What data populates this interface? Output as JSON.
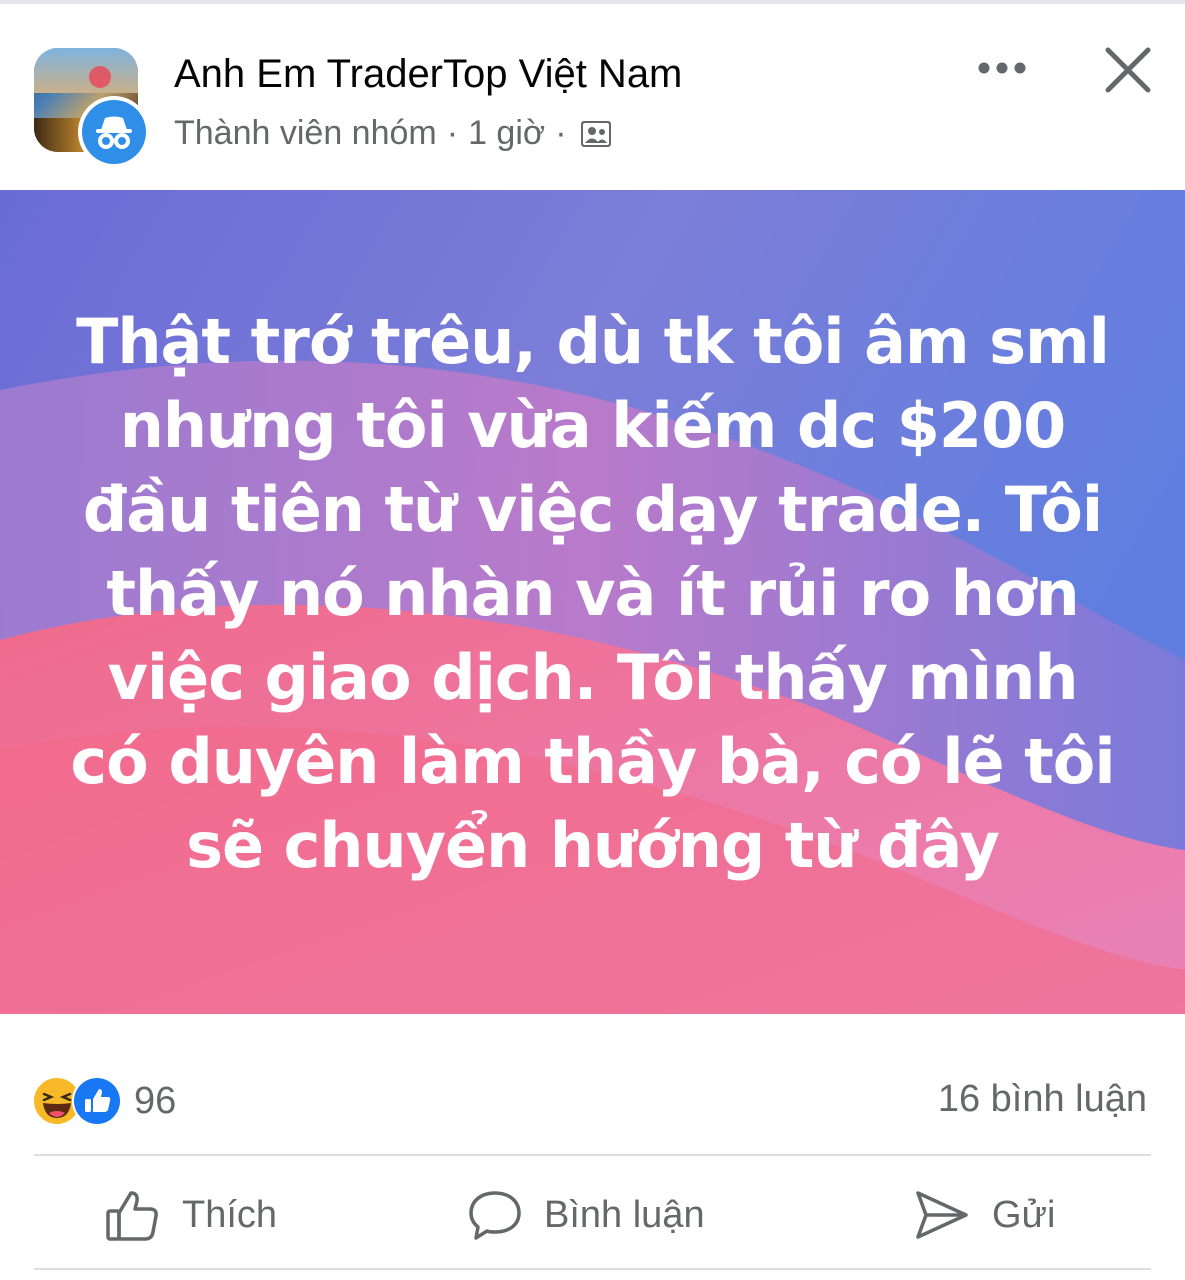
{
  "post": {
    "group_name": "Anh Em TraderTop Việt Nam",
    "author_role": "Thành viên nhóm",
    "time": "1 giờ",
    "separator": "·",
    "text": "Thật trớ trêu, dù tk tôi âm sml nhưng tôi vừa kiếm dc $200 đầu tiên từ việc dạy trade. Tôi thấy nó nhàn và ít rủi ro hơn việc giao dịch. Tôi thấy mình có duyên làm thầy bà, có lẽ tôi sẽ chuyển hướng từ đây",
    "background_colors": [
      "#6c70dc",
      "#8a7ad0",
      "#e0709a",
      "#f06a8a"
    ]
  },
  "icons": {
    "avatar_badge": "incognito-icon",
    "privacy": "group-members-icon",
    "more": "more-horizontal-icon",
    "close": "close-icon",
    "reaction_1": "haha-icon",
    "reaction_2": "like-icon"
  },
  "reactions": {
    "count": "96",
    "comments": "16 bình luận"
  },
  "actions": {
    "like_label": "Thích",
    "comment_label": "Bình luận",
    "send_label": "Gửi"
  },
  "colors": {
    "meta": "#65676b",
    "badge": "#2f8ee8",
    "like_blue": "#1877f2",
    "haha_yellow": "#f7b928"
  }
}
